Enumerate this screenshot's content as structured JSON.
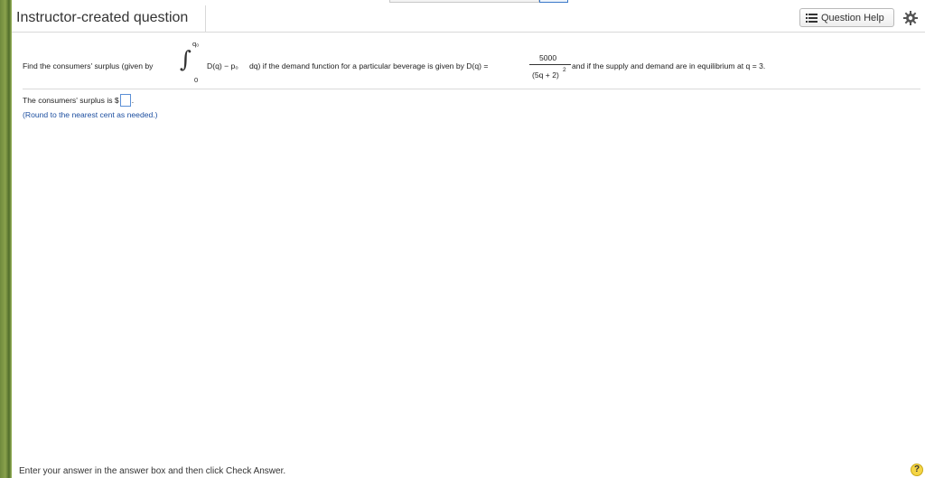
{
  "header": {
    "title": "Instructor-created question",
    "help_button_label": "Question Help",
    "help_icon": "list-icon",
    "settings_icon": "gear-icon"
  },
  "question": {
    "text_before_integral": "Find the consumers' surplus (given by",
    "integral_upper_limit": "q₀",
    "integral_lower_limit": "0",
    "integrand": "D(q) − p₀",
    "text_after_integral": "dq) if the demand function for a particular beverage is given by D(q) =",
    "demand_numerator": "5000",
    "demand_denominator": "(5q + 2)",
    "demand_exponent": "2",
    "text_after_fraction": "and if the supply and demand are in equilibrium at q = 3."
  },
  "answer": {
    "prefix": "The consumers' surplus is $",
    "suffix": ".",
    "value": "",
    "hint": "(Round to the nearest cent as needed.)"
  },
  "footer": {
    "instruction": "Enter your answer in the answer box and then click Check Answer.",
    "help_circle_label": "?"
  },
  "colors": {
    "accent_blue": "#1d4fa0",
    "answer_box_border": "#5b8fd6",
    "help_circle": "#f5d545"
  }
}
